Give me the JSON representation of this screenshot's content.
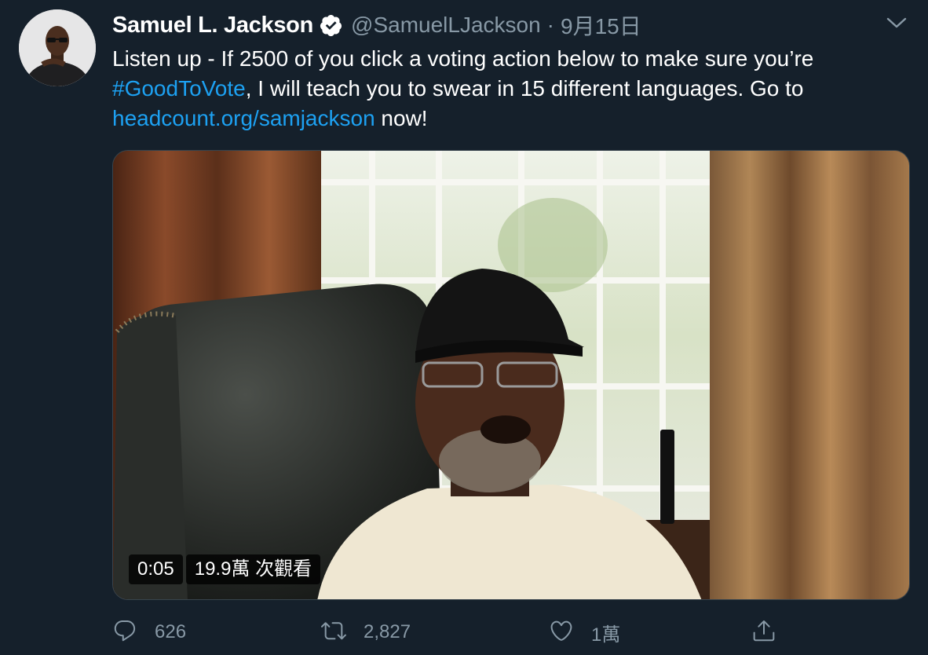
{
  "tweet": {
    "display_name": "Samuel L. Jackson",
    "handle": "@SamuelLJackson",
    "separator": "·",
    "date": "9月15日",
    "verified_icon": "verified-badge-icon",
    "text": {
      "part1": "Listen up - If 2500 of you click a voting action below to make sure you’re ",
      "hashtag": "#GoodToVote",
      "part2": ", I will teach you to swear in 15 different languages. Go to ",
      "link": "headcount.org/samjackson",
      "part3": " now!"
    },
    "video": {
      "time": "0:05",
      "views": "19.9萬 次觀看"
    },
    "actions": {
      "reply_count": "626",
      "retweet_count": "2,827",
      "like_count": "1萬",
      "reply_icon": "reply-icon",
      "retweet_icon": "retweet-icon",
      "like_icon": "heart-icon",
      "share_icon": "share-icon"
    }
  },
  "colors": {
    "background": "#15202b",
    "text": "#ffffff",
    "secondary": "#8899a6",
    "link": "#1da1f2"
  }
}
